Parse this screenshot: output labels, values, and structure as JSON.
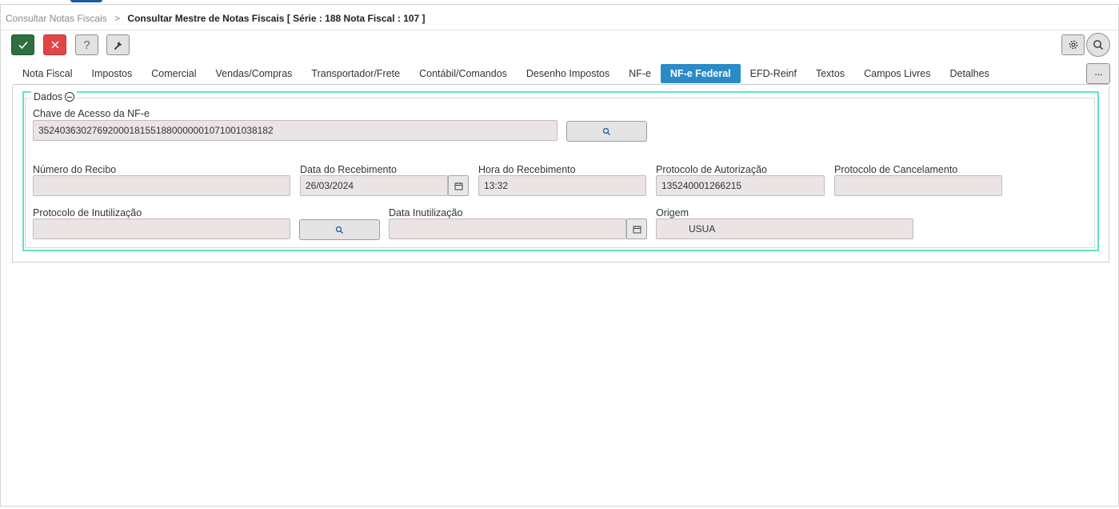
{
  "breadcrumb": {
    "parent": "Consultar Notas Fiscais",
    "separator": ">",
    "current": "Consultar Mestre de Notas Fiscais [ Série : 188 Nota Fiscal : 107 ]"
  },
  "toolbar": {
    "confirm_icon": "check-icon",
    "cancel_icon": "close-icon",
    "help_label": "?",
    "tools_icon": "wrench-icon",
    "settings_icon": "gear-icon",
    "search_icon": "search-icon",
    "more_label": "···"
  },
  "tabs": [
    {
      "label": "Nota Fiscal"
    },
    {
      "label": "Impostos"
    },
    {
      "label": "Comercial"
    },
    {
      "label": "Vendas/Compras"
    },
    {
      "label": "Transportador/Frete"
    },
    {
      "label": "Contábil/Comandos"
    },
    {
      "label": "Desenho Impostos"
    },
    {
      "label": "NF-e"
    },
    {
      "label": "NF-e Federal",
      "active": true
    },
    {
      "label": "EFD-Reinf"
    },
    {
      "label": "Textos"
    },
    {
      "label": "Campos Livres"
    },
    {
      "label": "Detalhes"
    }
  ],
  "section": {
    "title": "Dados",
    "fields": {
      "chave_label": "Chave de Acesso da NF-e",
      "chave_value": "35240363027692000181551880000001071001038182",
      "numero_recibo_label": "Número do Recibo",
      "numero_recibo_value": "",
      "data_recebimento_label": "Data do Recebimento",
      "data_recebimento_value": "26/03/2024",
      "hora_recebimento_label": "Hora do Recebimento",
      "hora_recebimento_value": "13:32",
      "protocolo_autorizacao_label": "Protocolo de Autorização",
      "protocolo_autorizacao_value": "135240001266215",
      "protocolo_cancelamento_label": "Protocolo de Cancelamento",
      "protocolo_cancelamento_value": "",
      "protocolo_inutilizacao_label": "Protocolo de Inutilização",
      "protocolo_inutilizacao_value": "",
      "data_inutilizacao_label": "Data Inutilização",
      "data_inutilizacao_value": "",
      "origem_label": "Origem",
      "origem_value": "USUA"
    }
  },
  "colors": {
    "confirm": "#2f6e3e",
    "cancel": "#e24545",
    "active_tab": "#2a8bc6",
    "focus_border": "#63e3c1",
    "input_bg": "#ebe4e4"
  }
}
